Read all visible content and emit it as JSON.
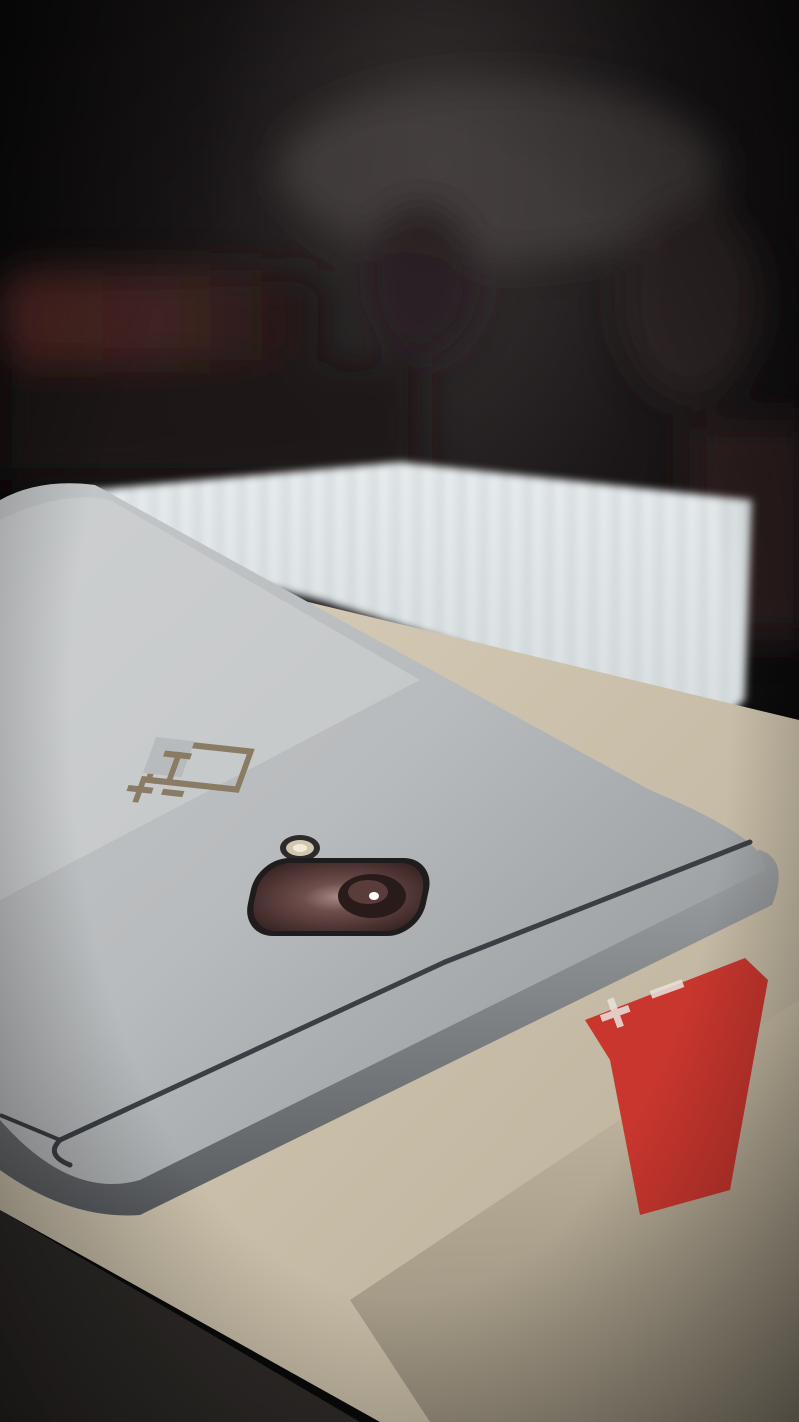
{
  "photo": {
    "subject": "smartphone-back-on-box",
    "colors": {
      "background_dark": "#0d0b0c",
      "background_warm": "#2a1a1a",
      "window_light": "#e9eef0",
      "phone_body": "#b7babc",
      "phone_highlight": "#d4d7d8",
      "antenna_line": "#3b3e44",
      "camera_ring": "#2a2728",
      "camera_lens": "#6b4a47",
      "box_top": "#d8cdb7",
      "box_side": "#c9bea8",
      "box_stripe": "#c8362e"
    },
    "logo": {
      "icon": "brand-logo-icon"
    },
    "box_stripe_mark": {
      "icon": "plus-minus-mark-icon"
    }
  }
}
